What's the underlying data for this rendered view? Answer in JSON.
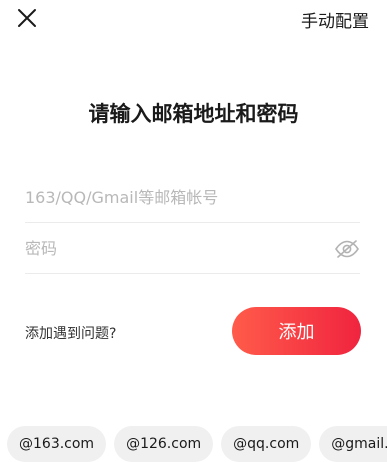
{
  "header": {
    "close_icon": "close-icon",
    "manual_config_label": "手动配置"
  },
  "title": "请输入邮箱地址和密码",
  "form": {
    "email_placeholder": "163/QQ/Gmail等邮箱帐号",
    "email_value": "",
    "password_placeholder": "密码",
    "password_value": "",
    "password_visibility_icon": "eye-off-icon"
  },
  "problem_link": "添加遇到问题?",
  "add_button_label": "添加",
  "domain_suggestions": [
    "@163.com",
    "@126.com",
    "@qq.com",
    "@gmail.com"
  ],
  "colors": {
    "accent_start": "#ff5b4a",
    "accent_end": "#f0243f",
    "chip_background": "#f0f0f0",
    "placeholder": "#b8b8b8"
  }
}
